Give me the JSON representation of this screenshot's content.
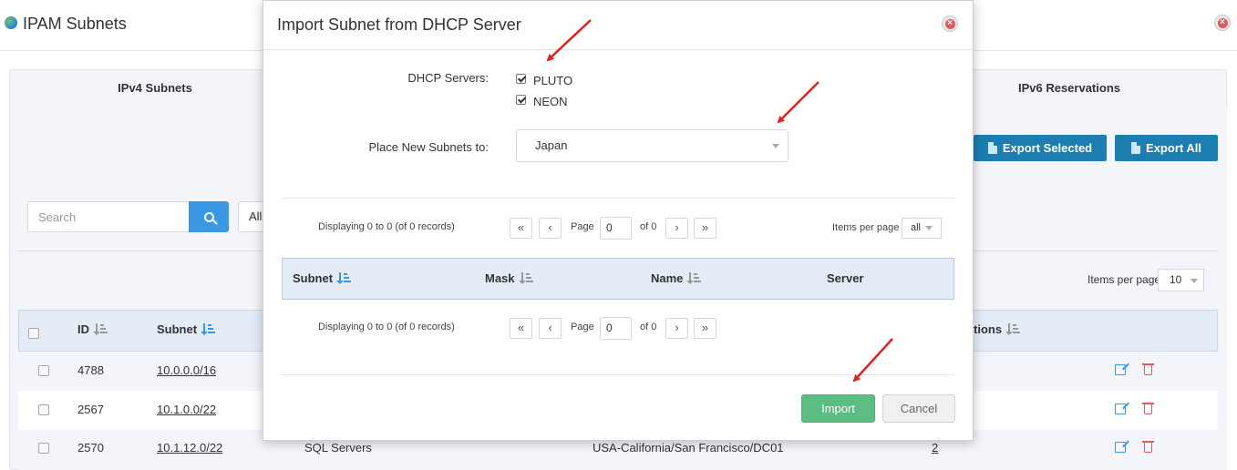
{
  "background": {
    "title": "IPAM Subnets",
    "tabs": [
      "IPv4 Subnets",
      "IPv6 Reservations"
    ],
    "export_selected": "Export Selected",
    "export_all": "Export All",
    "search_placeholder": "Search",
    "filter_value": "All",
    "items_per_page_label": "Items per page",
    "items_per_page_value": "10",
    "columns": [
      "ID",
      "Subnet",
      "tions"
    ],
    "rows": [
      {
        "id": "4788",
        "subnet": "10.0.0.0/16",
        "name": "",
        "location": "",
        "count": ""
      },
      {
        "id": "2567",
        "subnet": "10.1.0.0/22",
        "name": "",
        "location": "",
        "count": ""
      },
      {
        "id": "2570",
        "subnet": "10.1.12.0/22",
        "name": "SQL Servers",
        "location": "USA-California/San Francisco/DC01",
        "count": "2"
      }
    ]
  },
  "modal": {
    "title": "Import Subnet from DHCP Server",
    "dhcp_label": "DHCP Servers:",
    "servers": [
      {
        "name": "PLUTO",
        "checked": true
      },
      {
        "name": "NEON",
        "checked": true
      }
    ],
    "place_label": "Place New Subnets to:",
    "place_value": "Japan",
    "pager": {
      "displaying": "Displaying 0 to 0 (of 0 records)",
      "page_label": "Page",
      "page_value": "0",
      "of_label": "of 0",
      "items_per_page_label": "Items per page",
      "items_per_page_value": "all"
    },
    "columns": [
      "Subnet",
      "Mask",
      "Name",
      "Server"
    ],
    "import_label": "Import",
    "cancel_label": "Cancel"
  },
  "colors": {
    "primary": "#1c7eb0",
    "success": "#5cbd82",
    "table_header": "#e3ecf7",
    "annotation_arrow": "#e3201b"
  }
}
